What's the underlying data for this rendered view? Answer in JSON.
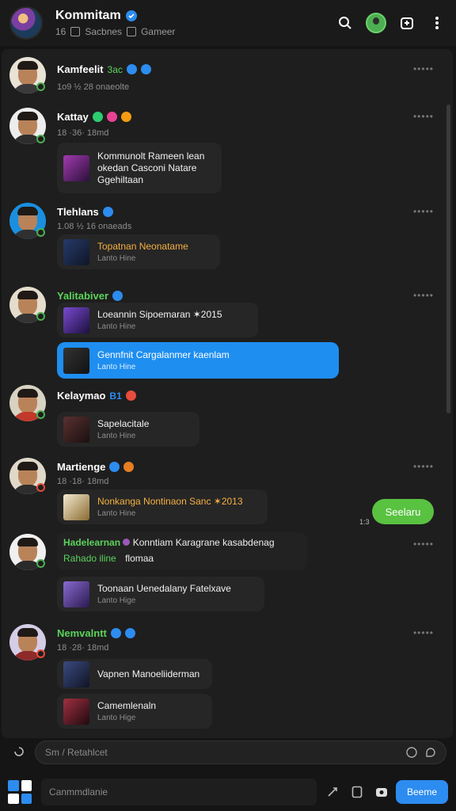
{
  "header": {
    "title": "Kommitam",
    "sub_count": "16",
    "sub_section": "Sacbnes",
    "sub_category": "Gameer"
  },
  "posts": [
    {
      "name": "Kamfeelit",
      "name_tag": "3ac",
      "meta": "1o9 ½ 28 onaeolte",
      "name_color": "white",
      "avatar_shirt": "#3a3a3a",
      "cards": []
    },
    {
      "name": "Kattay",
      "meta": "18 ·36· 18md",
      "name_color": "white",
      "avatar_shirt": "#2d2d2d",
      "cards": [
        {
          "text": "Kommunolt Rameen lean\nokedan Casconi Natare\nGgehiltaan",
          "sub": "",
          "thumb": "#6b2a7a",
          "style": "normal"
        }
      ]
    },
    {
      "name": "Tlehlans",
      "meta": "1.08 ½ 16 onaeads",
      "name_color": "white",
      "avatar_shirt": "#303030",
      "cards": [
        {
          "text": "Topatnan Neonatame",
          "sub": "Lanto Hine",
          "thumb": "#2a3550",
          "style": "gold"
        }
      ]
    },
    {
      "name": "Yalitabiver",
      "meta": "",
      "name_color": "green",
      "avatar_shirt": "#333",
      "cards": [
        {
          "text": "Loeannin Sipoemaran ✶2015",
          "sub": "Lanto Hine",
          "thumb": "#4a3a9a",
          "style": "normal"
        },
        {
          "text": "Gennfnit Cargalanmer kaenlam",
          "sub": "Lanto Hine",
          "thumb": "#2b2b2b",
          "style": "blue"
        }
      ]
    },
    {
      "name": "Kelaymao",
      "name_tag": "B1",
      "meta": "",
      "name_color": "white",
      "avatar_shirt": "#c0392b",
      "cards": [
        {
          "text": "Sapelacitale",
          "sub": "Lanto Hine",
          "thumb": "#3d2a2a",
          "style": "normal"
        }
      ]
    },
    {
      "name": "Martienge",
      "meta": "18 ·18· 18md",
      "name_color": "white",
      "avatar_shirt": "#2d2d2d",
      "cards": [
        {
          "text": "Nonkanga Nontinaon Sanc ✶2013",
          "sub": "Lanto Hine",
          "thumb": "#f0e6c8",
          "style": "gold"
        }
      ]
    },
    {
      "name": "Hadelearnan",
      "name_extra": "Konntiam Karagrane kasabdenag",
      "meta_green": "Rahado iline",
      "meta": "flomaa",
      "name_color": "green",
      "avatar_shirt": "#2a2a2a",
      "cards": [
        {
          "text": "Toonaan Uenedalany Fatelxave",
          "sub": "Lanto Hige",
          "thumb": "#5a4a8a",
          "style": "normal"
        }
      ]
    },
    {
      "name": "Nemvalntt",
      "meta": "18 ·28· 18md",
      "name_color": "green",
      "avatar_shirt": "#8e2a2a",
      "cards": [
        {
          "text": "Vapnen Manoeliiderman",
          "sub": "",
          "thumb": "#1f2a40",
          "style": "normal"
        },
        {
          "text": "Camemlenaln",
          "sub": "Lanto Hige",
          "thumb": "#5a1f2a",
          "style": "normal"
        }
      ]
    }
  ],
  "right_pill": {
    "label": "Seelaru",
    "time": "1:3"
  },
  "composer": {
    "placeholder": "Sm / Retahlcet"
  },
  "bottom": {
    "placeholder": "Canmmdlanie",
    "send_label": "Beeme"
  }
}
